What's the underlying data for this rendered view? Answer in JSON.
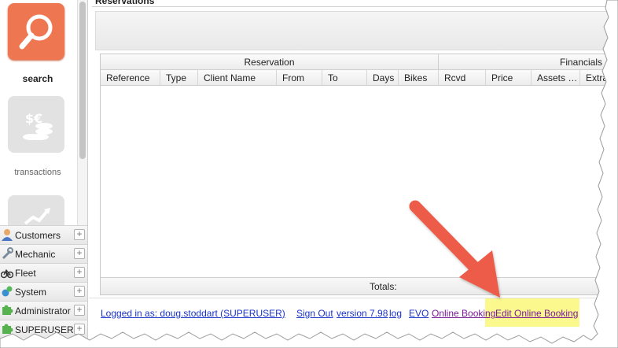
{
  "sidebar": {
    "tiles": [
      {
        "label": "search",
        "icon": "search-icon",
        "active": true
      },
      {
        "label": "transactions",
        "icon": "money-coins-icon",
        "active": false
      },
      {
        "label": "",
        "icon": "trend-chart-icon",
        "active": false
      }
    ],
    "nav": [
      {
        "label": "Customers",
        "icon": "customers-icon"
      },
      {
        "label": "Mechanic",
        "icon": "wrench-icon"
      },
      {
        "label": "Fleet",
        "icon": "bicycle-icon"
      },
      {
        "label": "System",
        "icon": "system-gears-icon"
      },
      {
        "label": "Administrator",
        "icon": "puzzle-icon"
      },
      {
        "label": "SUPERUSER",
        "icon": "puzzle-icon"
      }
    ]
  },
  "panel": {
    "title": "Reservations",
    "group_headers": {
      "reservation": "Reservation",
      "financials": "Financials"
    },
    "columns": [
      "Reference",
      "Type",
      "Client Name",
      "From",
      "To",
      "Days",
      "Bikes",
      "Rcvd",
      "Price",
      "Assets …",
      "Extras"
    ],
    "rows": [],
    "totals_label": "Totals:"
  },
  "status": {
    "logged_in": "Logged in as: doug.stoddart (SUPERUSER)",
    "sign_out": "Sign Out",
    "version": "version 7.98",
    "log": "log",
    "evo": "EVO",
    "online_booking": "Online Booking",
    "edit_online_booking": "Edit Online Booking"
  },
  "colors": {
    "active_tile": "#ee7651",
    "inactive_tile": "#e2e2e2",
    "link": "#1a33c8",
    "visited_link": "#7a1a9a",
    "highlight": "#fbf88d",
    "arrow": "#ec5b4a"
  }
}
